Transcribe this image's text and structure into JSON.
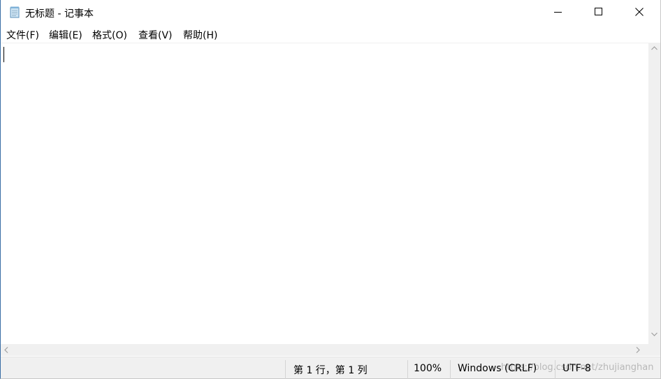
{
  "window": {
    "title": "无标题 - 记事本"
  },
  "controls": {
    "minimize_icon": "minimize-icon",
    "maximize_icon": "maximize-icon",
    "close_icon": "close-icon"
  },
  "menu": {
    "items": [
      {
        "label": "文件(F)"
      },
      {
        "label": "编辑(E)"
      },
      {
        "label": "格式(O)"
      },
      {
        "label": "查看(V)"
      },
      {
        "label": "帮助(H)"
      }
    ]
  },
  "editor": {
    "content": ""
  },
  "status": {
    "position": "第 1 行，第 1 列",
    "zoom": "100%",
    "line_ending": "Windows (CRLF)",
    "encoding": "UTF-8",
    "watermark": "https://blog.csdn.net/zhujianghan"
  },
  "colors": {
    "window_bg": "#ffffff",
    "chrome_bg": "#f0f0f0",
    "text": "#000000"
  }
}
